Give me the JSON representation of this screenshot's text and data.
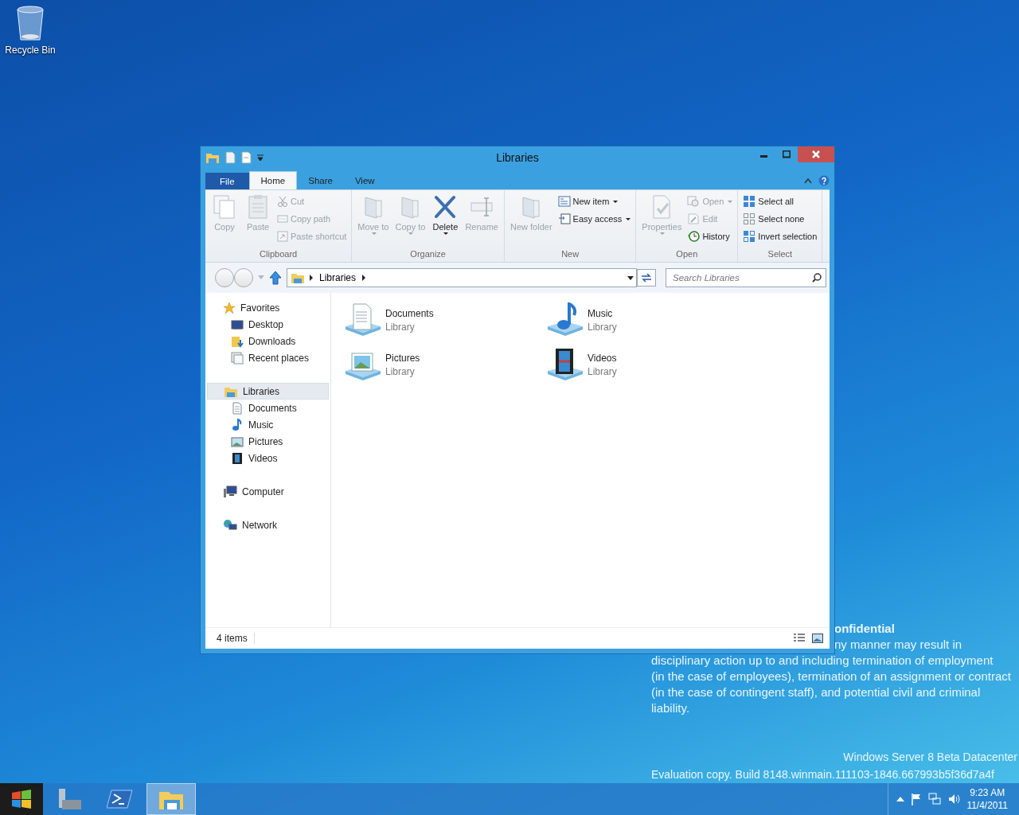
{
  "desktop_icons": [
    {
      "label": "Recycle Bin"
    }
  ],
  "window": {
    "title": "Libraries"
  },
  "ribbon_tabs": [
    {
      "label": "File",
      "kind": "file",
      "selected": false
    },
    {
      "label": "Home",
      "kind": "tab",
      "selected": true
    },
    {
      "label": "Share",
      "kind": "tab",
      "selected": false
    },
    {
      "label": "View",
      "kind": "tab",
      "selected": false
    }
  ],
  "ribbon_groups": [
    {
      "label": "Clipboard",
      "items": [
        {
          "kind": "large",
          "label": "Copy",
          "disabled": true,
          "dropdown": false
        },
        {
          "kind": "large",
          "label": "Paste",
          "disabled": true,
          "dropdown": false
        },
        {
          "kind": "stack",
          "items": [
            {
              "label": "Cut",
              "disabled": true,
              "dropdown": false
            },
            {
              "label": "Copy path",
              "disabled": true,
              "dropdown": false
            },
            {
              "label": "Paste shortcut",
              "disabled": true,
              "dropdown": false
            }
          ]
        }
      ]
    },
    {
      "label": "Organize",
      "items": [
        {
          "kind": "large",
          "label": "Move to",
          "disabled": true,
          "dropdown": true
        },
        {
          "kind": "large",
          "label": "Copy to",
          "disabled": true,
          "dropdown": true
        },
        {
          "kind": "large",
          "label": "Delete",
          "disabled": false,
          "dropdown": true
        },
        {
          "kind": "large",
          "label": "Rename",
          "disabled": true,
          "dropdown": false
        }
      ]
    },
    {
      "label": "New",
      "items": [
        {
          "kind": "large",
          "label": "New folder",
          "disabled": true,
          "dropdown": false
        },
        {
          "kind": "stack",
          "items": [
            {
              "label": "New item",
              "disabled": false,
              "dropdown": true
            },
            {
              "label": "Easy access",
              "disabled": false,
              "dropdown": true
            }
          ]
        }
      ]
    },
    {
      "label": "Open",
      "items": [
        {
          "kind": "large",
          "label": "Properties",
          "disabled": true,
          "dropdown": true
        },
        {
          "kind": "stack",
          "items": [
            {
              "label": "Open",
              "disabled": true,
              "dropdown": true
            },
            {
              "label": "Edit",
              "disabled": true,
              "dropdown": false
            },
            {
              "label": "History",
              "disabled": false,
              "dropdown": false
            }
          ]
        }
      ]
    },
    {
      "label": "Select",
      "items": [
        {
          "kind": "stack",
          "items": [
            {
              "label": "Select all",
              "disabled": false,
              "dropdown": false
            },
            {
              "label": "Select none",
              "disabled": false,
              "dropdown": false
            },
            {
              "label": "Invert selection",
              "disabled": false,
              "dropdown": false
            }
          ]
        }
      ]
    }
  ],
  "address_bar": {
    "path": [
      "Libraries"
    ],
    "search_placeholder": "Search Libraries"
  },
  "navigation": [
    {
      "label": "Favorites",
      "selected": false,
      "children": [
        {
          "label": "Desktop",
          "selected": false
        },
        {
          "label": "Downloads",
          "selected": false
        },
        {
          "label": "Recent places",
          "selected": false
        }
      ]
    },
    {
      "label": "Libraries",
      "selected": true,
      "children": [
        {
          "label": "Documents",
          "selected": false
        },
        {
          "label": "Music",
          "selected": false
        },
        {
          "label": "Pictures",
          "selected": false
        },
        {
          "label": "Videos",
          "selected": false
        }
      ]
    },
    {
      "label": "Computer",
      "selected": false
    },
    {
      "label": "Network",
      "selected": false
    }
  ],
  "items": [
    {
      "name": "Documents",
      "type": "Library"
    },
    {
      "name": "Music",
      "type": "Library"
    },
    {
      "name": "Pictures",
      "type": "Library"
    },
    {
      "name": "Videos",
      "type": "Library"
    }
  ],
  "status_bar": {
    "count": "4 items"
  },
  "watermark_text": {
    "partial_lines": [
      "onfidential",
      "ny manner may result in"
    ],
    "lines": [
      "disciplinary action up to and including termination of employment",
      "(in the case of employees), termination of an assignment or contract",
      "(in the case of contingent staff), and potential civil and criminal",
      "liability."
    ],
    "edition": "Windows Server 8 Beta Datacenter",
    "build": "Evaluation copy. Build 8148.winmain.111103-1846.667993b5f36d7a4f"
  },
  "taskbar": {
    "apps": [
      {
        "selected": false
      },
      {
        "selected": false
      },
      {
        "selected": true
      }
    ],
    "time": "9:23 AM",
    "date": "11/4/2011"
  }
}
